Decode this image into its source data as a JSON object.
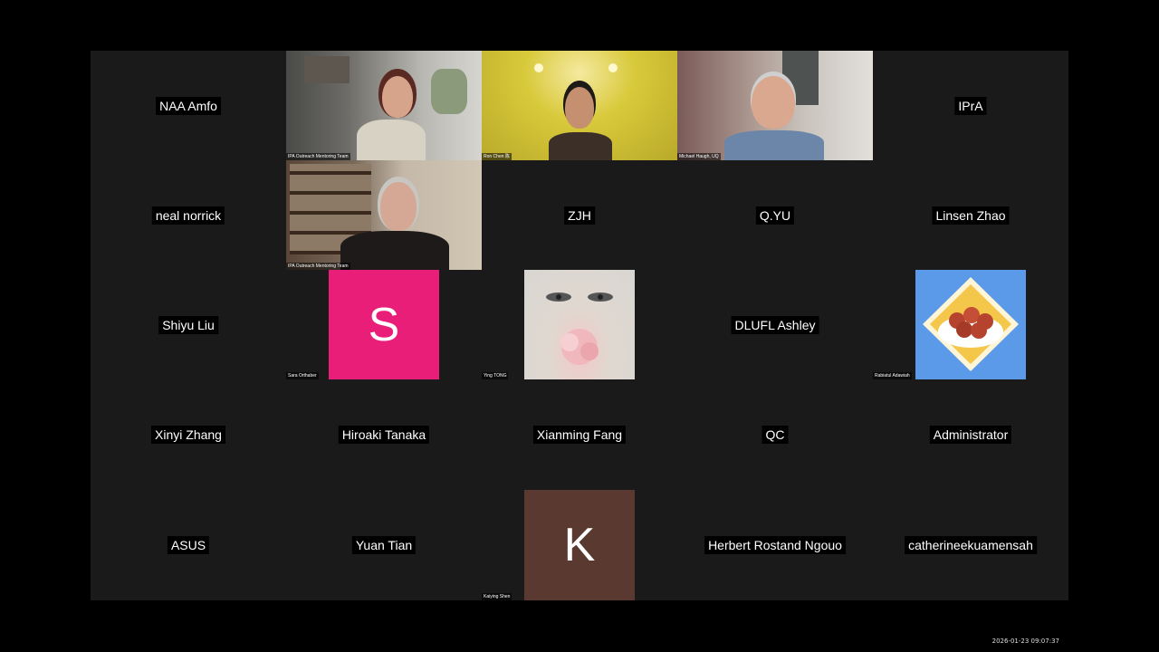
{
  "participants": [
    {
      "name": "NAA Amfo",
      "kind": "name"
    },
    {
      "name": "IPA Outreach Mentoring Team",
      "kind": "video"
    },
    {
      "name": "Ron Chen 陈",
      "kind": "video"
    },
    {
      "name": "Michael Haugh, UQ",
      "kind": "video"
    },
    {
      "name": "IPrA",
      "kind": "name"
    },
    {
      "name": "neal norrick",
      "kind": "name"
    },
    {
      "name": "IPA Outreach Mentoring Team",
      "kind": "video"
    },
    {
      "name": "ZJH",
      "kind": "name"
    },
    {
      "name": "Q.YU",
      "kind": "name"
    },
    {
      "name": "Linsen Zhao",
      "kind": "name"
    },
    {
      "name": "Shiyu Liu",
      "kind": "name"
    },
    {
      "name": "Sara Orthaber",
      "kind": "avatar",
      "initial": "S",
      "color": "#e91e78"
    },
    {
      "name": "Ying TONG",
      "kind": "picture"
    },
    {
      "name": "DLUFL Ashley",
      "kind": "name"
    },
    {
      "name": "Rabiatul Adawiah",
      "kind": "picture"
    },
    {
      "name": "Xinyi Zhang",
      "kind": "name"
    },
    {
      "name": "Hiroaki Tanaka",
      "kind": "name"
    },
    {
      "name": "Xianming Fang",
      "kind": "name"
    },
    {
      "name": "QC",
      "kind": "name"
    },
    {
      "name": "Administrator",
      "kind": "name"
    },
    {
      "name": "ASUS",
      "kind": "name"
    },
    {
      "name": "Yuan Tian",
      "kind": "name"
    },
    {
      "name": "Kaiying Shen",
      "kind": "avatar",
      "initial": "K",
      "color": "#5a3a30"
    },
    {
      "name": "Herbert Rostand Ngouo",
      "kind": "name"
    },
    {
      "name": "catherineekuamensah",
      "kind": "name"
    }
  ],
  "timestamp": "2026-01-23 09:07:37"
}
